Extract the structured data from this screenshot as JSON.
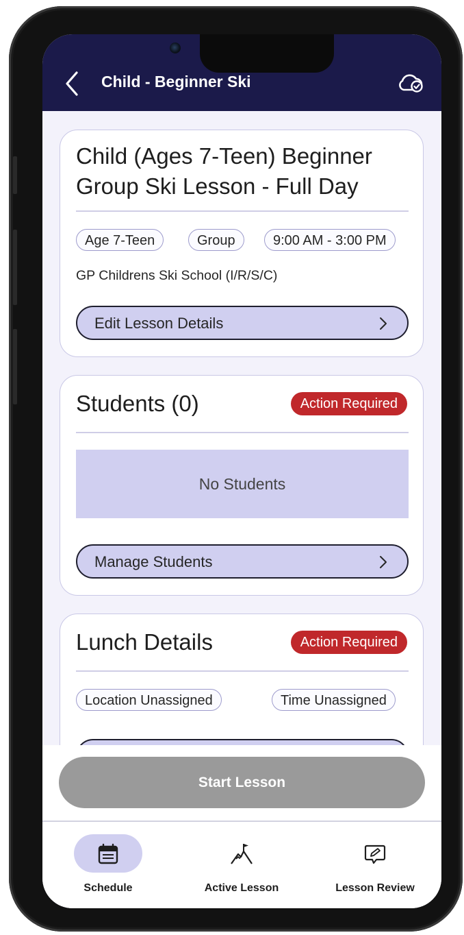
{
  "header": {
    "title": "Child - Beginner Ski"
  },
  "lesson_card": {
    "title_line1": "Child (Ages 7-Teen) Beginner",
    "title_line2": "Group Ski Lesson - Full Day",
    "chips": [
      "Age 7-Teen",
      "Group",
      "9:00 AM - 3:00 PM"
    ],
    "school": "GP Childrens Ski School (I/R/S/C)",
    "edit_button_label": "Edit Lesson Details"
  },
  "students_card": {
    "title": "Students (0)",
    "badge": "Action Required",
    "empty_message": "No Students",
    "manage_button_label": "Manage Students"
  },
  "lunch_card": {
    "title": "Lunch Details",
    "badge": "Action Required",
    "chips": [
      "Location Unassigned",
      "Time Unassigned"
    ]
  },
  "footer": {
    "start_button_label": "Start Lesson",
    "nav": [
      {
        "label": "Schedule",
        "icon": "calendar-icon",
        "active": true
      },
      {
        "label": "Active Lesson",
        "icon": "mountain-flag-icon",
        "active": false
      },
      {
        "label": "Lesson Review",
        "icon": "pencil-chat-icon",
        "active": false
      }
    ]
  },
  "colors": {
    "header_bg": "#1b1a4a",
    "accent_light": "#d0cff0",
    "badge_red": "#c0282b",
    "disabled_button": "#9a9a9a"
  }
}
